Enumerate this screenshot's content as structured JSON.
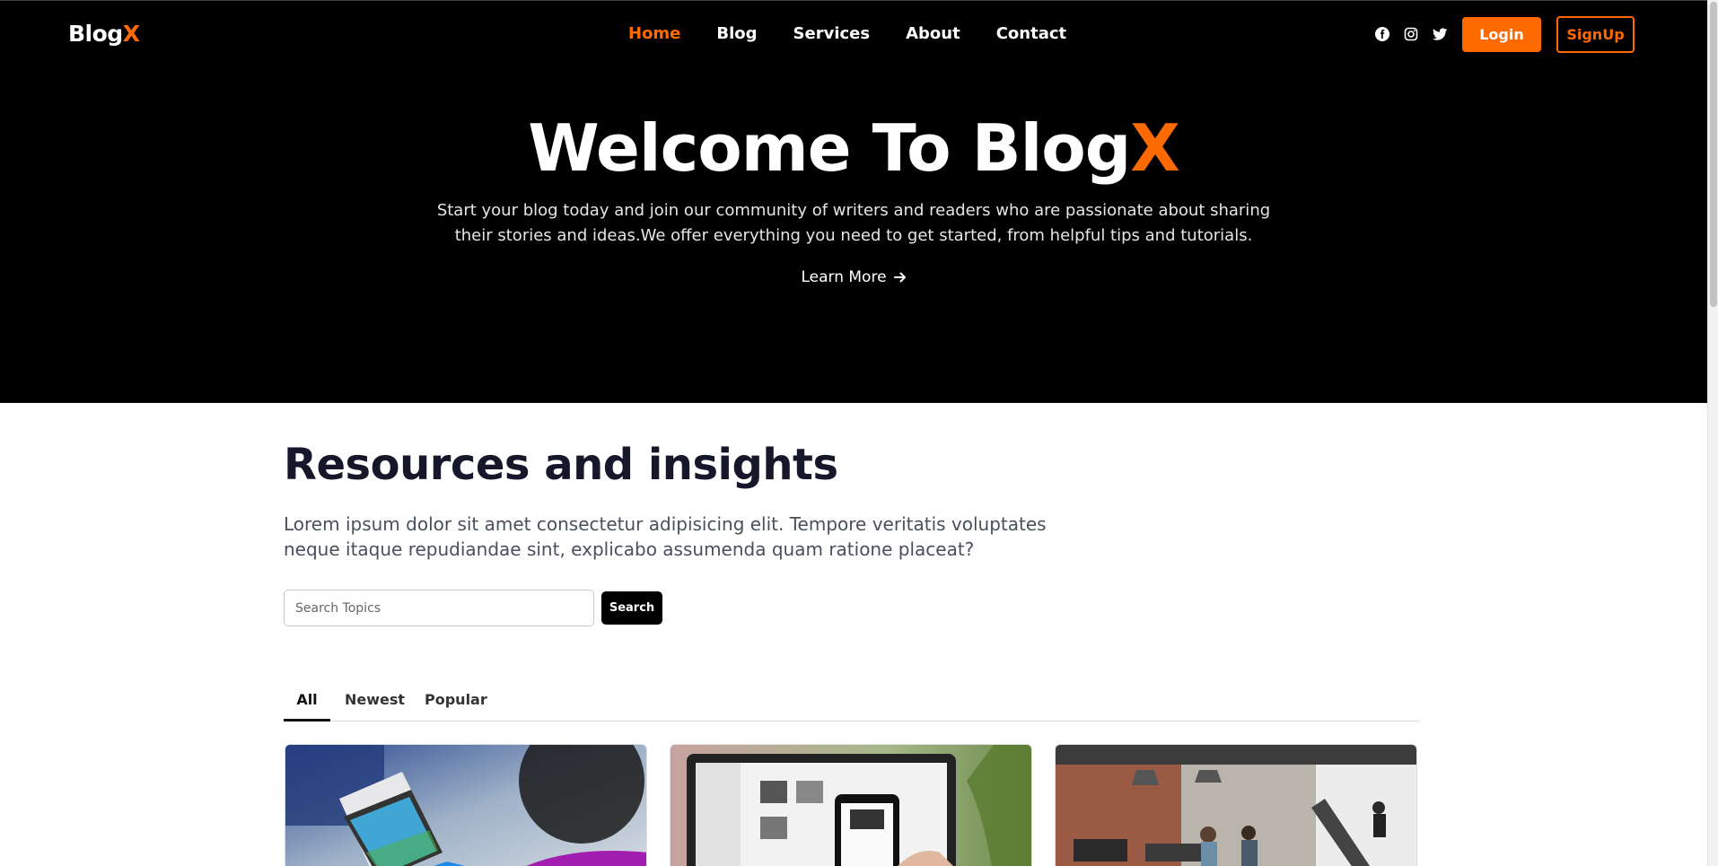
{
  "brand": {
    "name": "Blog",
    "accent_letter": "X",
    "accent_color": "#ff6a00"
  },
  "nav": {
    "items": [
      {
        "label": "Home",
        "active": true
      },
      {
        "label": "Blog",
        "active": false
      },
      {
        "label": "Services",
        "active": false
      },
      {
        "label": "About",
        "active": false
      },
      {
        "label": "Contact",
        "active": false
      }
    ],
    "social_icons": [
      "facebook-icon",
      "instagram-icon",
      "twitter-icon"
    ],
    "login_label": "Login",
    "signup_label": "SignUp"
  },
  "hero": {
    "title_main": "Welcome To Blog",
    "title_accent": "X",
    "description": "Start your blog today and join our community of writers and readers who are passionate about sharing their stories and ideas.We offer everything you need to get started, from helpful tips and tutorials.",
    "cta_label": "Learn More"
  },
  "resources": {
    "title": "Resources and insights",
    "description": "Lorem ipsum dolor sit amet consectetur adipisicing elit. Tempore veritatis voluptates neque itaque repudiandae sint, explicabo assumenda quam ratione placeat?",
    "search_placeholder": "Search Topics",
    "search_button": "Search",
    "tabs": [
      {
        "label": "All",
        "active": true
      },
      {
        "label": "Newest",
        "active": false
      },
      {
        "label": "Popular",
        "active": false
      }
    ]
  },
  "cards": [
    {
      "image": "laptop-tablet-photo"
    },
    {
      "image": "phone-camera-shopping-photo"
    },
    {
      "image": "office-workspace-photo"
    }
  ]
}
